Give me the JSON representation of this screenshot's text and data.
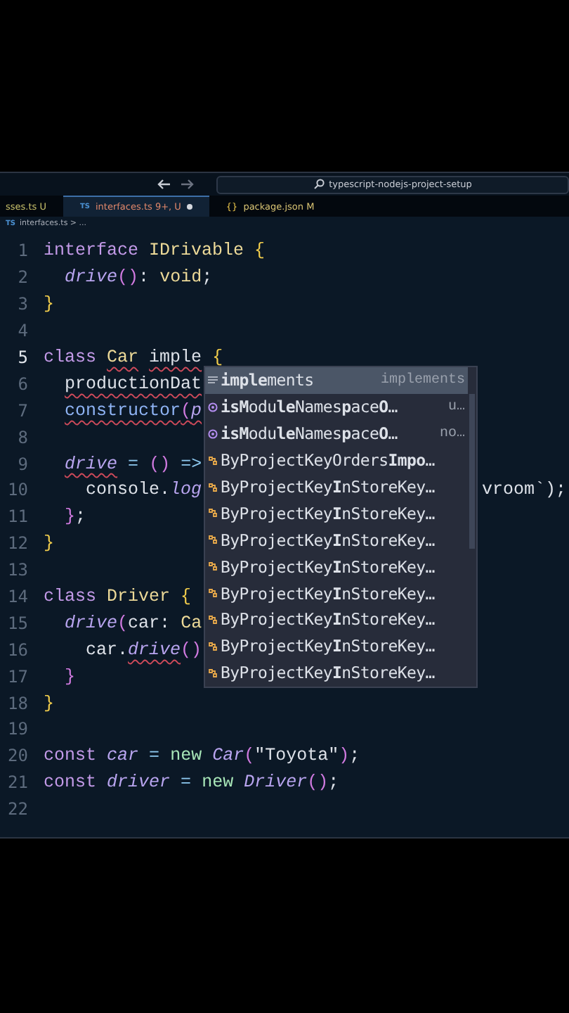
{
  "title_bar": {
    "search": "typescript-nodejs-project-setup"
  },
  "tabs": [
    {
      "label": "sses.ts",
      "status": "U",
      "color": "#c8c06a",
      "modified": false,
      "selected": false
    },
    {
      "icon_text": "TS",
      "label": "interfaces.ts",
      "status": "9+, U",
      "color": "#e0876a",
      "modified": true,
      "selected": true
    },
    {
      "icon_text": "{}",
      "label": "package.json",
      "status": "M",
      "color": "#d8c373",
      "modified": false,
      "selected": false
    }
  ],
  "breadcrumb": {
    "icon_text": "TS",
    "path": "interfaces.ts > ..."
  },
  "lines": [
    {
      "n": "1",
      "current": false,
      "tokens": [
        {
          "text": "interface ",
          "kind": "kw",
          "error": false
        },
        {
          "text": "IDrivable ",
          "kind": "type",
          "error": false
        },
        {
          "text": "{",
          "kind": "brace",
          "error": false
        }
      ]
    },
    {
      "n": "2",
      "current": false,
      "tokens": [
        {
          "text": "  drive",
          "kind": "fn",
          "error": false
        },
        {
          "text": "()",
          "kind": "paren",
          "error": false
        },
        {
          "text": ": ",
          "kind": "plain",
          "error": false
        },
        {
          "text": "void",
          "kind": "type",
          "error": false
        },
        {
          "text": ";",
          "kind": "plain",
          "error": false
        }
      ]
    },
    {
      "n": "3",
      "current": false,
      "tokens": [
        {
          "text": "}",
          "kind": "brace",
          "error": false
        }
      ]
    },
    {
      "n": "4",
      "current": false
    },
    {
      "n": "5",
      "current": true,
      "tokens": [
        {
          "text": "class ",
          "kind": "kw",
          "error": false
        },
        {
          "text": "Car",
          "kind": "type",
          "error": true
        },
        {
          "text": " imple",
          "kind": "plain",
          "error": true
        },
        {
          "text": " {",
          "kind": "brace"
        }
      ]
    },
    {
      "n": "6",
      "current": false,
      "tokens": [
        {
          "text": "  productionDat",
          "kind": "plain",
          "error": true
        }
      ]
    },
    {
      "n": "7",
      "current": false,
      "tokens": [
        {
          "text": "  constructor",
          "kind": "ctor",
          "error": true
        },
        {
          "text": "(",
          "kind": "paren",
          "error": true
        },
        {
          "text": "p",
          "kind": "fn",
          "error": true
        }
      ]
    },
    {
      "n": "8",
      "current": false
    },
    {
      "n": "9",
      "current": false,
      "tokens": [
        {
          "text": "  drive",
          "kind": "fn",
          "error": true
        },
        {
          "text": " = ",
          "kind": "op",
          "error": false
        },
        {
          "text": "()",
          "kind": "paren",
          "error": false
        },
        {
          "text": " =>",
          "kind": "op",
          "error": false
        }
      ]
    },
    {
      "n": "10",
      "current": false,
      "tokens": [
        {
          "text": "    console.",
          "kind": "plain",
          "error": false
        },
        {
          "text": "log",
          "kind": "fn",
          "error": false
        }
      ],
      "tail": [
        {
          "text": "vroom`);",
          "kind": "plain",
          "error": false
        }
      ]
    },
    {
      "n": "11",
      "current": false,
      "tokens": [
        {
          "text": "  }",
          "kind": "paren",
          "error": false
        },
        {
          "text": ";",
          "kind": "plain",
          "error": false
        }
      ]
    },
    {
      "n": "12",
      "current": false,
      "tokens": [
        {
          "text": "}",
          "kind": "brace",
          "error": false
        }
      ]
    },
    {
      "n": "13",
      "current": false
    },
    {
      "n": "14",
      "current": false,
      "tokens": [
        {
          "text": "class ",
          "kind": "kw",
          "error": false
        },
        {
          "text": "Driver ",
          "kind": "type",
          "error": false
        },
        {
          "text": "{",
          "kind": "brace",
          "error": false
        }
      ]
    },
    {
      "n": "15",
      "current": false,
      "tokens": [
        {
          "text": "  drive",
          "kind": "fn",
          "error": false
        },
        {
          "text": "(",
          "kind": "paren",
          "error": false
        },
        {
          "text": "car: ",
          "kind": "plain",
          "error": false
        },
        {
          "text": "Ca",
          "kind": "type",
          "error": false
        }
      ]
    },
    {
      "n": "16",
      "current": false,
      "tokens": [
        {
          "text": "    car.",
          "kind": "plain",
          "error": false
        },
        {
          "text": "drive",
          "kind": "fn",
          "error": true
        },
        {
          "text": "()",
          "kind": "paren",
          "error": false
        }
      ]
    },
    {
      "n": "17",
      "current": false,
      "tokens": [
        {
          "text": "  }",
          "kind": "paren",
          "error": false
        }
      ]
    },
    {
      "n": "18",
      "current": false,
      "tokens": [
        {
          "text": "}",
          "kind": "brace",
          "error": false
        }
      ]
    },
    {
      "n": "19",
      "current": false
    },
    {
      "n": "20",
      "current": false,
      "tokens": [
        {
          "text": "const ",
          "kind": "kw",
          "error": false
        },
        {
          "text": "car",
          "kind": "fn",
          "error": false
        },
        {
          "text": " = ",
          "kind": "op",
          "error": false
        },
        {
          "text": "new ",
          "kind": "new",
          "error": false
        },
        {
          "text": "Car",
          "kind": "fn",
          "error": false
        },
        {
          "text": "(",
          "kind": "paren",
          "error": false
        },
        {
          "text": "\"Toyota\"",
          "kind": "plain",
          "error": false
        },
        {
          "text": ")",
          "kind": "paren",
          "error": false
        },
        {
          "text": ";",
          "kind": "plain",
          "error": false
        }
      ]
    },
    {
      "n": "21",
      "current": false,
      "tokens": [
        {
          "text": "const ",
          "kind": "kw",
          "error": false
        },
        {
          "text": "driver",
          "kind": "fn",
          "error": false
        },
        {
          "text": " = ",
          "kind": "op",
          "error": false
        },
        {
          "text": "new ",
          "kind": "new",
          "error": false
        },
        {
          "text": "Driver",
          "kind": "fn",
          "error": false
        },
        {
          "text": "()",
          "kind": "paren",
          "error": false
        },
        {
          "text": ";",
          "kind": "plain",
          "error": false
        }
      ]
    },
    {
      "n": "22",
      "current": false
    }
  ],
  "suggestions": [
    {
      "kind": "keyword",
      "label": "**imple**ments",
      "detail": "implements",
      "selected": true
    },
    {
      "kind": "method",
      "label": "**isM**odu**le**Names**p**ace**O**…",
      "detail": "u…",
      "selected": false
    },
    {
      "kind": "method",
      "label": "**isM**odu**le**Names**p**ace**O**…",
      "detail": "no…",
      "selected": false
    },
    {
      "kind": "class",
      "label": "ByProjectKeyOrders**Impo**…",
      "selected": false
    },
    {
      "kind": "class",
      "label": "ByProjectKey**I**nStoreKey…",
      "selected": false
    },
    {
      "kind": "class",
      "label": "ByProjectKey**I**nStoreKey…",
      "selected": false
    },
    {
      "kind": "class",
      "label": "ByProjectKey**I**nStoreKey…",
      "selected": false
    },
    {
      "kind": "class",
      "label": "ByProjectKey**I**nStoreKey…",
      "selected": false
    },
    {
      "kind": "class",
      "label": "ByProjectKey**I**nStoreKey…",
      "selected": false
    },
    {
      "kind": "class",
      "label": "ByProjectKey**I**nStoreKey…",
      "selected": false
    },
    {
      "kind": "class",
      "label": "ByProjectKey**I**nStoreKey…",
      "selected": false
    },
    {
      "kind": "class",
      "label": "ByProjectKey**I**nStoreKey…",
      "selected": false
    }
  ]
}
